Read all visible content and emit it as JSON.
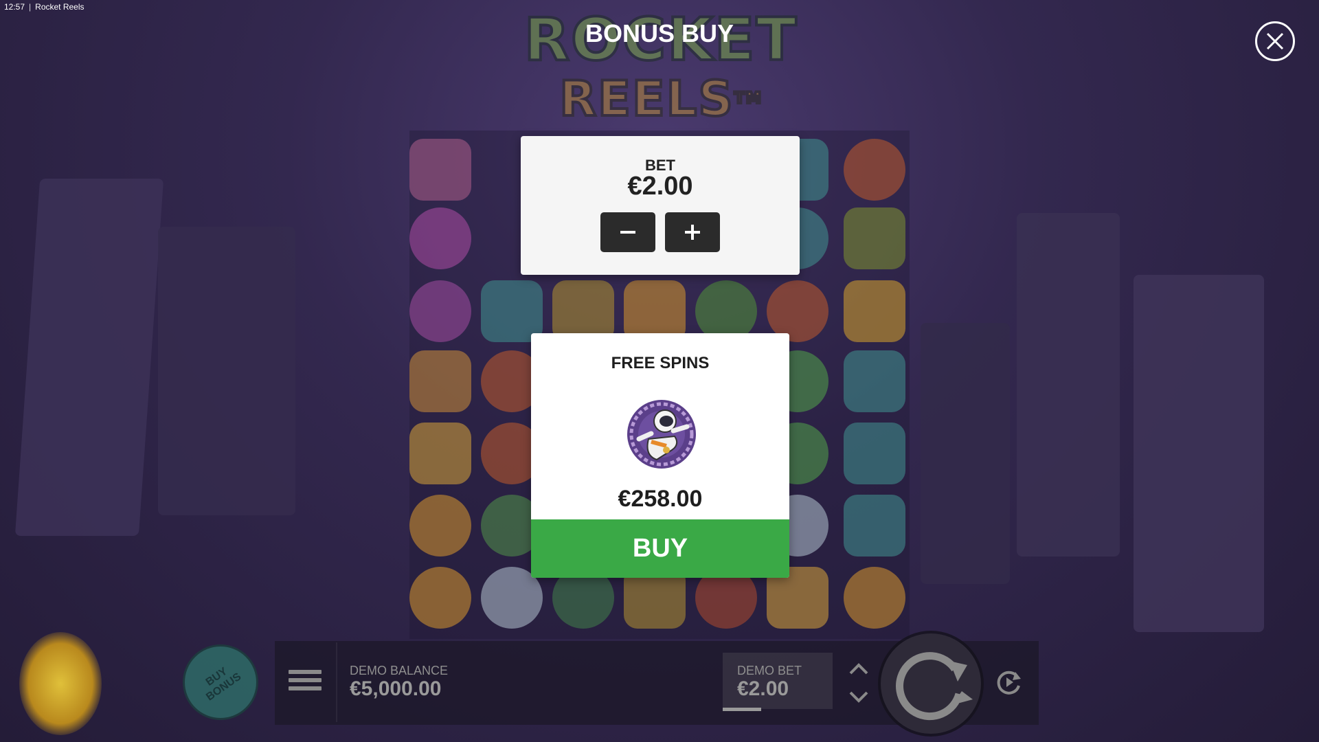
{
  "status_bar": {
    "time": "12:57",
    "separator": "|",
    "window_title": "Rocket Reels"
  },
  "logo": {
    "line1": "ROCKET",
    "line2": "REELS",
    "trademark": "TM"
  },
  "dialog": {
    "title": "BONUS BUY",
    "close_icon": "close-icon",
    "bet_panel": {
      "label": "BET",
      "value": "€2.00",
      "decrease_icon": "minus-icon",
      "increase_icon": "plus-icon"
    },
    "bonus_card": {
      "title": "FREE SPINS",
      "icon": "astronaut-icon",
      "price": "€258.00",
      "buy_label": "BUY"
    }
  },
  "hud": {
    "buy_bonus_line1": "BUY",
    "buy_bonus_line2": "BONUS",
    "menu_icon": "hamburger-menu-icon",
    "balance_label": "DEMO BALANCE",
    "balance_value": "€5,000.00",
    "bet_label": "DEMO BET",
    "bet_value": "€2.00",
    "bet_up_icon": "chevron-up-icon",
    "bet_down_icon": "chevron-down-icon",
    "spin_icon": "spin-arrow-icon",
    "autoplay_icon": "autoplay-icon"
  },
  "colors": {
    "buy_button": "#3aa946",
    "panel_background": "#f5f5f5",
    "stepper_button": "#2b2b2b",
    "backdrop": "#33284f"
  }
}
